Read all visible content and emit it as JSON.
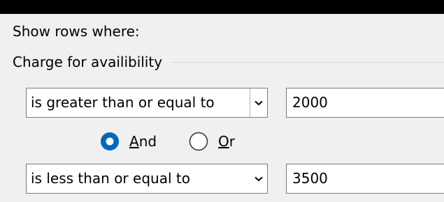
{
  "filter": {
    "show_rows_label": "Show rows where:",
    "column_name": "Charge for availibility",
    "condition1": {
      "operator": "is greater than or equal to",
      "value": "2000"
    },
    "logic": {
      "and_accel": "A",
      "and_rest": "nd",
      "or_accel": "O",
      "or_rest": "r",
      "selected": "And"
    },
    "condition2": {
      "operator": "is less than or equal to",
      "value": "3500"
    }
  },
  "colors": {
    "accent": "#0067c0",
    "dialog_bg": "#f0f0f0",
    "border": "#7a7a7a"
  }
}
